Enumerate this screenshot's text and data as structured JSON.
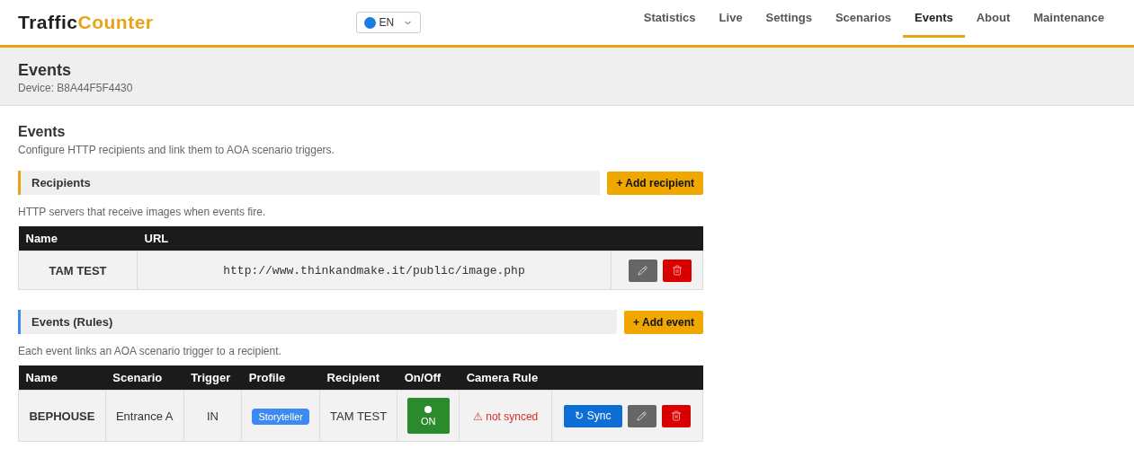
{
  "brand": {
    "part_1": "Traffic",
    "part_2": "Counter"
  },
  "language": {
    "value": "EN"
  },
  "nav": [
    {
      "label": "Statistics",
      "selected": false
    },
    {
      "label": "Live",
      "selected": false
    },
    {
      "label": "Settings",
      "selected": false
    },
    {
      "label": "Scenarios",
      "selected": false
    },
    {
      "label": "Events",
      "selected": true
    },
    {
      "label": "About",
      "selected": false
    },
    {
      "label": "Maintenance",
      "selected": false
    }
  ],
  "page_header": {
    "title": "Events",
    "subtitle": "Device: B8A44F5F4430"
  },
  "intro": {
    "title": "Events",
    "description": "Configure HTTP recipients and link them to AOA scenario triggers."
  },
  "recipients": {
    "title": "Recipients",
    "add_button": "+ Add recipient",
    "description": "HTTP servers that receive images when events fire.",
    "columns": [
      "Name",
      "URL"
    ],
    "rows": [
      {
        "name": "TAM TEST",
        "url": "http://www.thinkandmake.it/public/image.php"
      }
    ]
  },
  "events": {
    "title": "Events (Rules)",
    "add_button": "+ Add event",
    "description": "Each event links an AOA scenario trigger to a recipient.",
    "columns": [
      "Name",
      "Scenario",
      "Trigger",
      "Profile",
      "Recipient",
      "On/Off",
      "Camera Rule"
    ],
    "rows": [
      {
        "name": "BEPHOUSE",
        "scenario": "Entrance A",
        "trigger": "IN",
        "profile": "Storyteller",
        "recipient": "TAM TEST",
        "on": true,
        "toggle_label": "ON",
        "camera_rule": "⚠ not synced",
        "sync_button": "↻ Sync"
      }
    ]
  }
}
